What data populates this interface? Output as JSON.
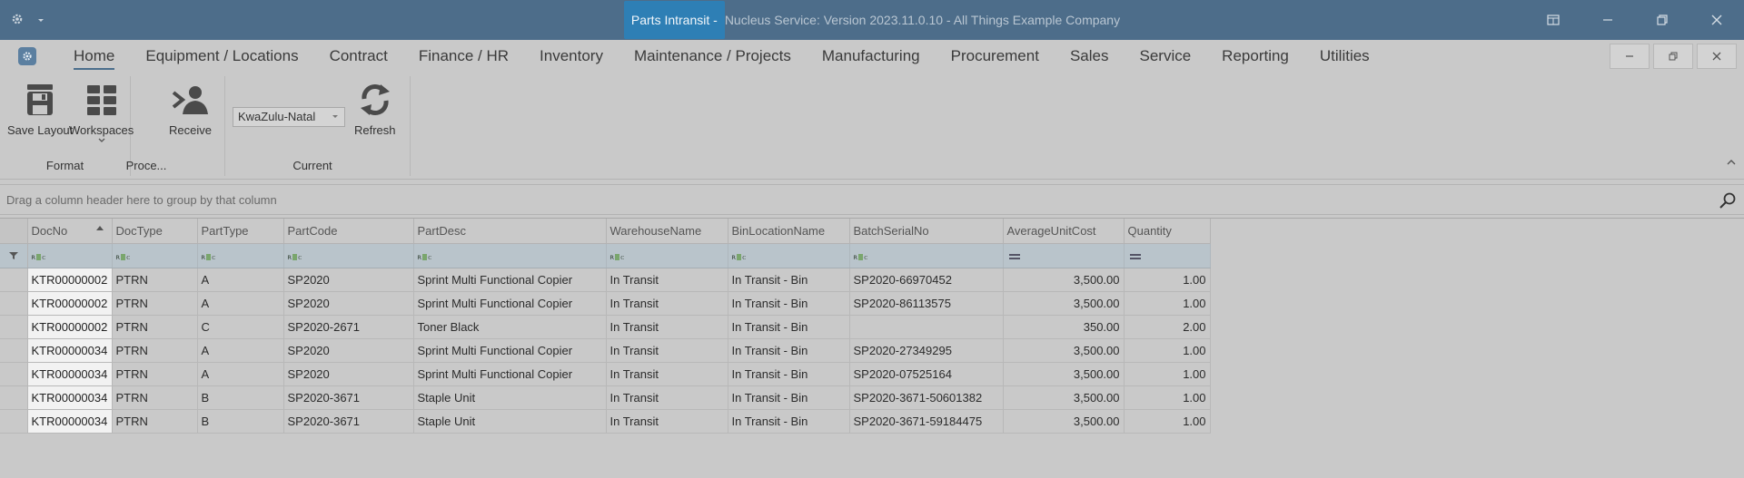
{
  "titlebar": {
    "app_menu_icon": "gear-icon",
    "active_doc": "Parts Intransit - ",
    "rest": "Nucleus Service: Version 2023.11.0.10 - All Things Example Company",
    "controls": [
      "ribbon-toggle-icon",
      "minimize-icon",
      "restore-icon",
      "close-icon"
    ]
  },
  "menu": {
    "items": [
      "Home",
      "Equipment / Locations",
      "Contract",
      "Finance / HR",
      "Inventory",
      "Maintenance / Projects",
      "Manufacturing",
      "Procurement",
      "Sales",
      "Service",
      "Reporting",
      "Utilities"
    ],
    "active": "Home"
  },
  "ribbon": {
    "groups": {
      "format": {
        "label": "Format",
        "save_layout": "Save Layout",
        "workspaces": "Workspaces"
      },
      "process": {
        "label": "Proce...",
        "receive": "Receive"
      },
      "current": {
        "label": "Current",
        "region_selected": "KwaZulu-Natal",
        "refresh": "Refresh"
      }
    }
  },
  "grid": {
    "group_panel_text": "Drag a column header here to group by that column",
    "columns": [
      "DocNo",
      "DocType",
      "PartType",
      "PartCode",
      "PartDesc",
      "WarehouseName",
      "BinLocationName",
      "BatchSerialNo",
      "AverageUnitCost",
      "Quantity"
    ],
    "sorted_column": "DocNo",
    "sort_direction": "ascending",
    "rows": [
      [
        "KTR00000002",
        "PTRN",
        "A",
        "SP2020",
        "Sprint Multi Functional Copier",
        "In Transit",
        "In Transit - Bin",
        "SP2020-66970452",
        "3,500.00",
        "1.00"
      ],
      [
        "KTR00000002",
        "PTRN",
        "A",
        "SP2020",
        "Sprint Multi Functional Copier",
        "In Transit",
        "In Transit - Bin",
        "SP2020-86113575",
        "3,500.00",
        "1.00"
      ],
      [
        "KTR00000002",
        "PTRN",
        "C",
        "SP2020-2671",
        "Toner Black",
        "In Transit",
        "In Transit - Bin",
        "",
        "350.00",
        "2.00"
      ],
      [
        "KTR00000034",
        "PTRN",
        "A",
        "SP2020",
        "Sprint Multi Functional Copier",
        "In Transit",
        "In Transit - Bin",
        "SP2020-27349295",
        "3,500.00",
        "1.00"
      ],
      [
        "KTR00000034",
        "PTRN",
        "A",
        "SP2020",
        "Sprint Multi Functional Copier",
        "In Transit",
        "In Transit - Bin",
        "SP2020-07525164",
        "3,500.00",
        "1.00"
      ],
      [
        "KTR00000034",
        "PTRN",
        "B",
        "SP2020-3671",
        "Staple Unit",
        "In Transit",
        "In Transit - Bin",
        "SP2020-3671-50601382",
        "3,500.00",
        "1.00"
      ],
      [
        "KTR00000034",
        "PTRN",
        "B",
        "SP2020-3671",
        "Staple Unit",
        "In Transit",
        "In Transit - Bin",
        "SP2020-3671-59184475",
        "3,500.00",
        "1.00"
      ]
    ]
  }
}
